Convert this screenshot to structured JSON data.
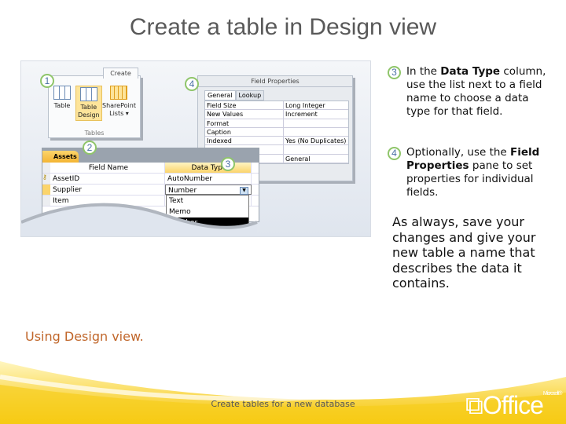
{
  "title": "Create a table in Design view",
  "screenshot": {
    "ribbon": {
      "tab": "Create",
      "buttons": [
        {
          "label1": "Table",
          "label2": ""
        },
        {
          "label1": "Table",
          "label2": "Design"
        },
        {
          "label1": "SharePoint",
          "label2": "Lists ▾"
        }
      ],
      "group": "Tables"
    },
    "field_properties": {
      "title": "Field Properties",
      "tabs": [
        "General",
        "Lookup"
      ],
      "rows": [
        [
          "Field Size",
          "Long Integer"
        ],
        [
          "New Values",
          "Increment"
        ],
        [
          "Format",
          ""
        ],
        [
          "Caption",
          ""
        ],
        [
          "Indexed",
          "Yes (No Duplicates)"
        ],
        [
          "",
          ""
        ],
        [
          "",
          "General"
        ]
      ]
    },
    "assets": {
      "tab": "Assets",
      "headers": [
        "Field Name",
        "Data Type"
      ],
      "rows": [
        [
          "AssetID",
          "AutoNumber"
        ],
        [
          "Supplier",
          "Number"
        ],
        [
          "Item",
          ""
        ]
      ]
    },
    "dropdown": [
      "Text",
      "Memo",
      "Number"
    ],
    "callouts": [
      "1",
      "2",
      "3",
      "4"
    ]
  },
  "steps": [
    {
      "num": "3",
      "pre": "In the ",
      "bold": "Data Type",
      "post": " column, use the list next to a field name to choose a data type for that field."
    },
    {
      "num": "4",
      "pre": "Optionally, use the ",
      "bold": "Field Properties",
      "post": " pane to set properties for individual fields."
    }
  ],
  "summary": "As always, save your changes and give your new table a name that describes the data it contains.",
  "caption": "Using Design view.",
  "footer": "Create tables for a new database",
  "logo": {
    "text": "Office",
    "brand": "Microsoft®"
  }
}
